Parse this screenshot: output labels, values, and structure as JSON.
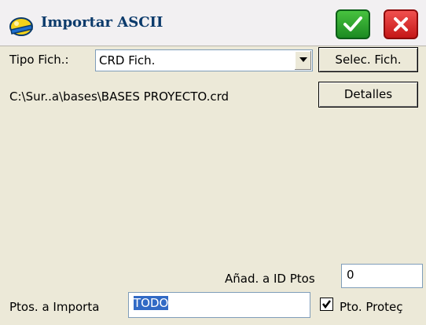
{
  "window": {
    "title": "Importar ASCII",
    "icons": {
      "app": "helmet-icon",
      "ok": "checkmark-icon",
      "close": "x-close-icon"
    },
    "colors": {
      "ok_button": "#28a12f",
      "close_button": "#d92020",
      "title_text": "#0b3a6b",
      "selection": "#316ac5"
    }
  },
  "form": {
    "file_type_label": "Tipo Fich.:",
    "file_type_value": "CRD Fich.",
    "select_file_button": "Selec. Fich.",
    "file_path": "C:\\Sur..a\\bases\\BASES PROYECTO.crd",
    "details_button": "Detalles",
    "add_to_id_label": "Añad. a ID Ptos",
    "add_to_id_value": "0",
    "points_to_import_label": "Ptos. a Importa",
    "points_to_import_value": "TODO",
    "protect_points_label": "Pto. Proteç",
    "protect_points_checked": true
  }
}
